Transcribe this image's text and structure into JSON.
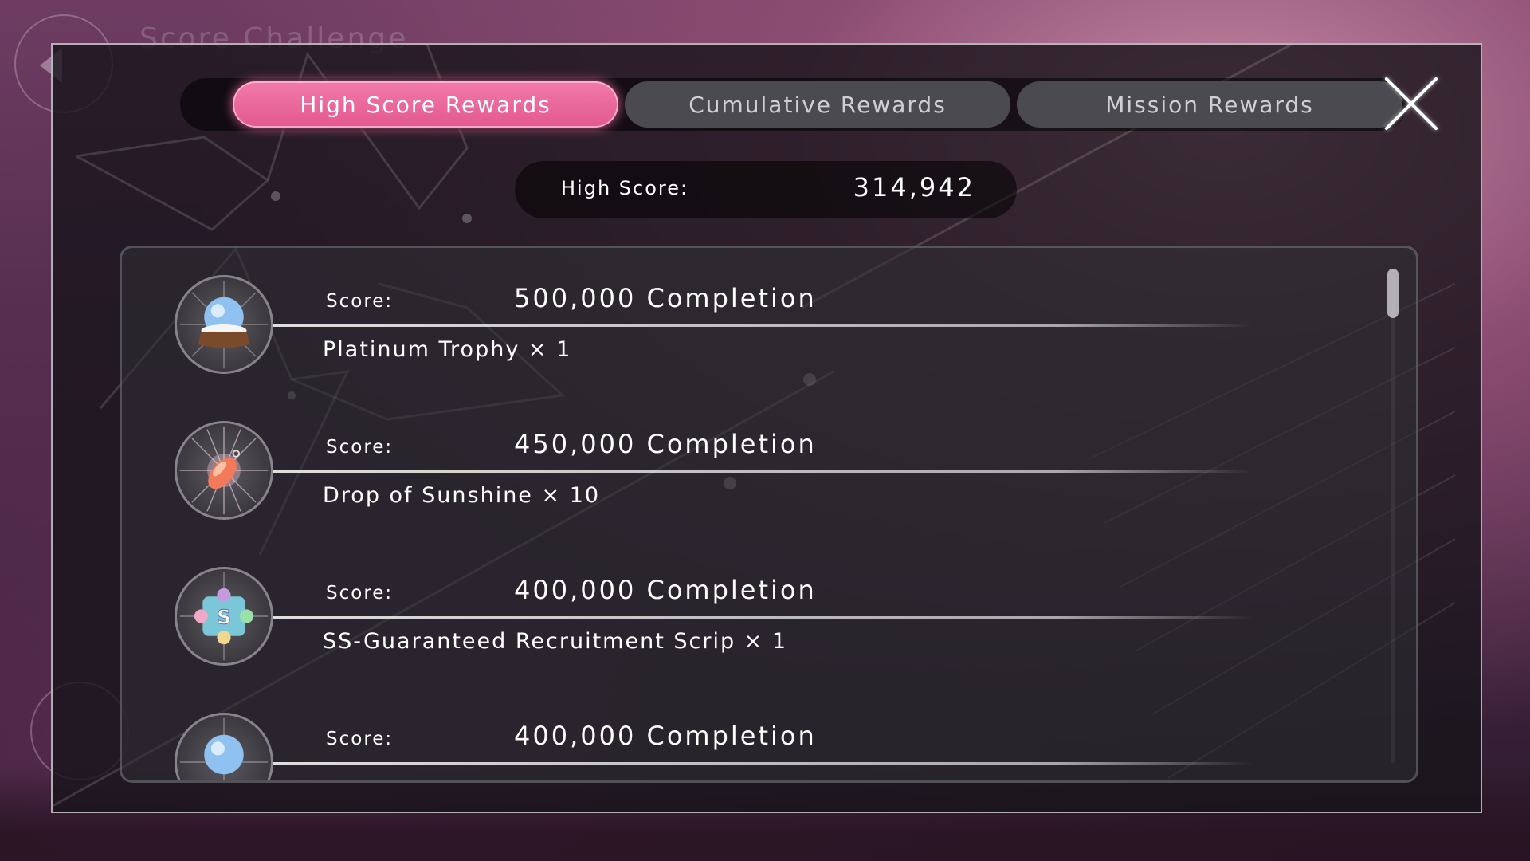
{
  "background": {
    "faded_title": "Score Challenge"
  },
  "tabs": [
    {
      "label": "High Score Rewards",
      "active": true
    },
    {
      "label": "Cumulative Rewards",
      "active": false
    },
    {
      "label": "Mission Rewards",
      "active": false
    }
  ],
  "high_score": {
    "label": "High Score:",
    "value": "314,942"
  },
  "rewards": [
    {
      "score_label": "Score:",
      "score_text": "500,000 Completion",
      "reward": "Platinum Trophy × 1",
      "icon": "crystal-ball-icon"
    },
    {
      "score_label": "Score:",
      "score_text": "450,000 Completion",
      "reward": "Drop of Sunshine × 10",
      "icon": "sunshine-drop-icon"
    },
    {
      "score_label": "Score:",
      "score_text": "400,000 Completion",
      "reward": "SS-Guaranteed Recruitment Scrip × 1",
      "icon": "puzzle-scrip-icon"
    },
    {
      "score_label": "Score:",
      "score_text": "400,000 Completion",
      "reward": "",
      "icon": "crystal-ball-icon"
    }
  ],
  "colors": {
    "active_tab": "#e2588f",
    "inactive_tab": "#4b4a50",
    "modal_bg": "#16141a"
  }
}
